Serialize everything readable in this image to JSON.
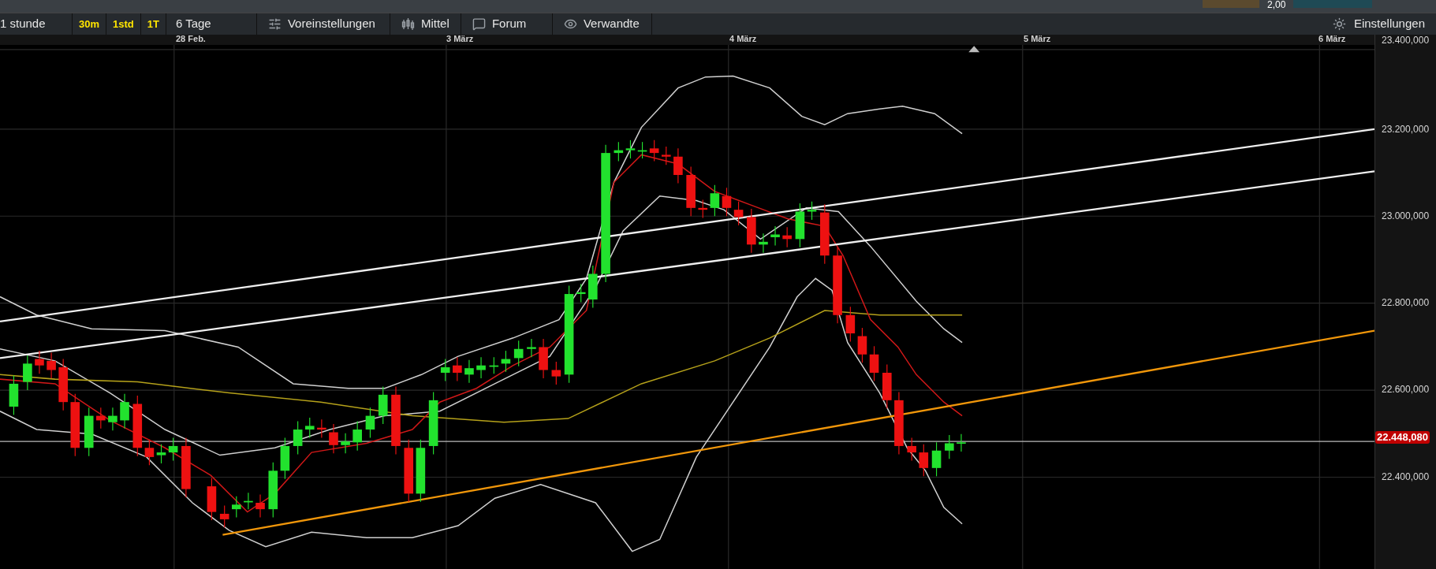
{
  "top_strip": {
    "value": "2,00"
  },
  "toolbar": {
    "timeframe": "1 stunde",
    "intervals": [
      "30m",
      "1std",
      "1T"
    ],
    "range": "6 Tage",
    "buttons": [
      "Voreinstellungen",
      "Mittel",
      "Forum",
      "Verwandte"
    ],
    "settings": "Einstellungen"
  },
  "date_axis": [
    "28 Feb.",
    "3 März",
    "4 März",
    "5 März",
    "6 März"
  ],
  "price_axis": [
    "23.400,000",
    "23.200,000",
    "23.000,000",
    "22.800,000",
    "22.600,000",
    "22.400,000"
  ],
  "current_price": "22.448,080"
}
